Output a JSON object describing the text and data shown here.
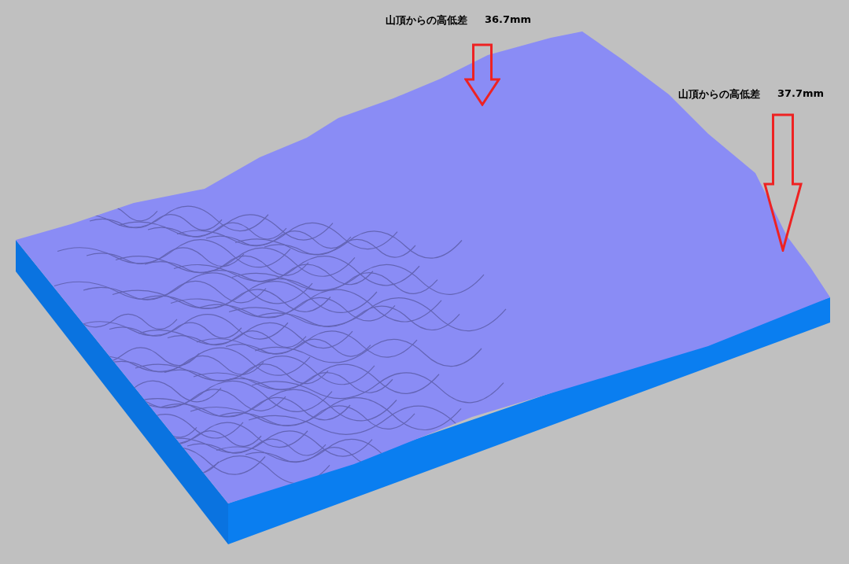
{
  "annotations": [
    {
      "label": "山頂からの高低差",
      "value": "36.7mm"
    },
    {
      "label": "山頂からの高低差",
      "value": "37.7mm"
    }
  ]
}
